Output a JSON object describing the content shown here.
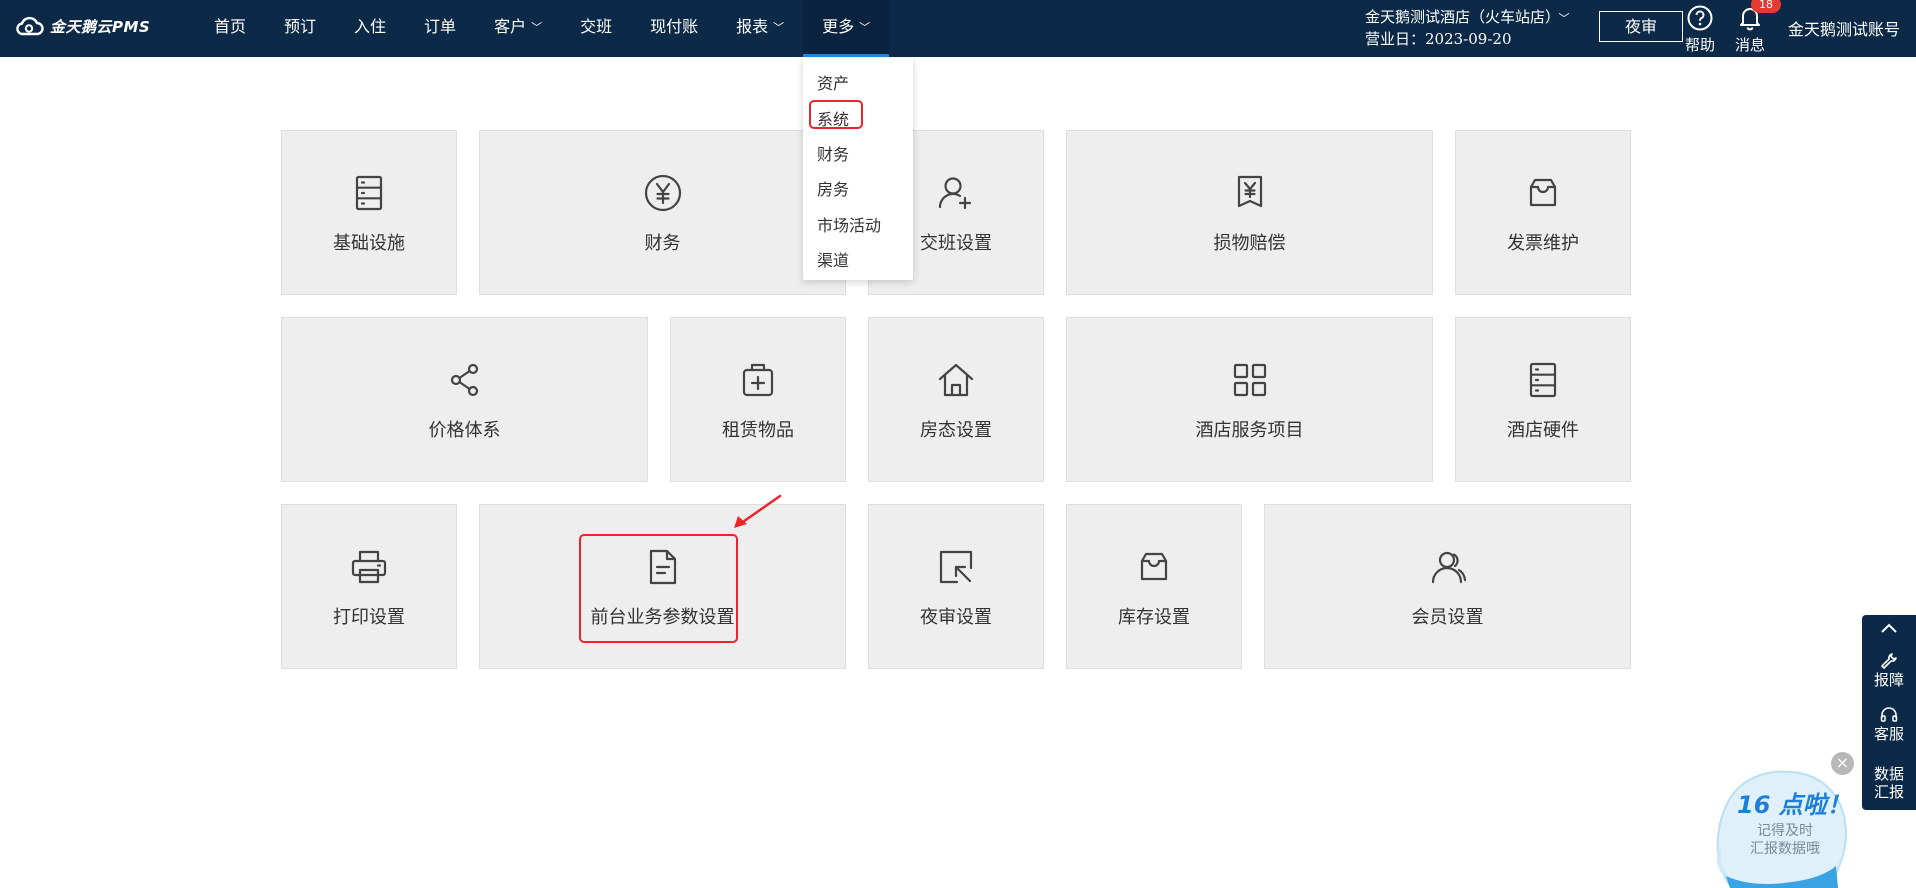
{
  "brand": {
    "name": "金天鹅云PMS"
  },
  "nav": [
    {
      "label": "首页",
      "dropdown": false,
      "active": false
    },
    {
      "label": "预订",
      "dropdown": false,
      "active": false
    },
    {
      "label": "入住",
      "dropdown": false,
      "active": false
    },
    {
      "label": "订单",
      "dropdown": false,
      "active": false
    },
    {
      "label": "客户",
      "dropdown": true,
      "active": false
    },
    {
      "label": "交班",
      "dropdown": false,
      "active": false
    },
    {
      "label": "现付账",
      "dropdown": false,
      "active": false
    },
    {
      "label": "报表",
      "dropdown": true,
      "active": false
    },
    {
      "label": "更多",
      "dropdown": true,
      "active": true
    }
  ],
  "header": {
    "hotel_name": "金天鹅测试酒店（火车站店）",
    "business_date": "营业日：2023-09-20",
    "night_audit_button": "夜审",
    "help_label": "帮助",
    "messages_label": "消息",
    "messages_count": "18",
    "account_name": "金天鹅测试账号"
  },
  "more_menu": [
    "资产",
    "系统",
    "财务",
    "房务",
    "市场活动",
    "渠道"
  ],
  "tiles": [
    {
      "label": "基础设施",
      "icon": "server-rack-icon"
    },
    {
      "label": "财务",
      "icon": "yen-circle-icon"
    },
    {
      "label": "交班设置",
      "icon": "user-add-icon"
    },
    {
      "label": "损物赔偿",
      "icon": "yen-receipt-icon"
    },
    {
      "label": "发票维护",
      "icon": "inbox-icon"
    },
    {
      "label": "价格体系",
      "icon": "share-nodes-icon"
    },
    {
      "label": "租赁物品",
      "icon": "medical-bag-icon"
    },
    {
      "label": "房态设置",
      "icon": "house-icon"
    },
    {
      "label": "酒店服务项目",
      "icon": "grid-icon"
    },
    {
      "label": "酒店硬件",
      "icon": "server-rack-icon"
    },
    {
      "label": "打印设置",
      "icon": "printer-icon"
    },
    {
      "label": "前台业务参数设置",
      "icon": "document-icon"
    },
    {
      "label": "夜审设置",
      "icon": "cursor-box-icon"
    },
    {
      "label": "库存设置",
      "icon": "inbox-icon"
    },
    {
      "label": "会员设置",
      "icon": "users-icon"
    }
  ],
  "side_panel": {
    "report_issue": "报障",
    "customer_service": "客服",
    "data_report": "数据汇报"
  },
  "promo": {
    "title": "16 点啦！",
    "line1": "记得及时",
    "line2": "汇报数据哦"
  }
}
